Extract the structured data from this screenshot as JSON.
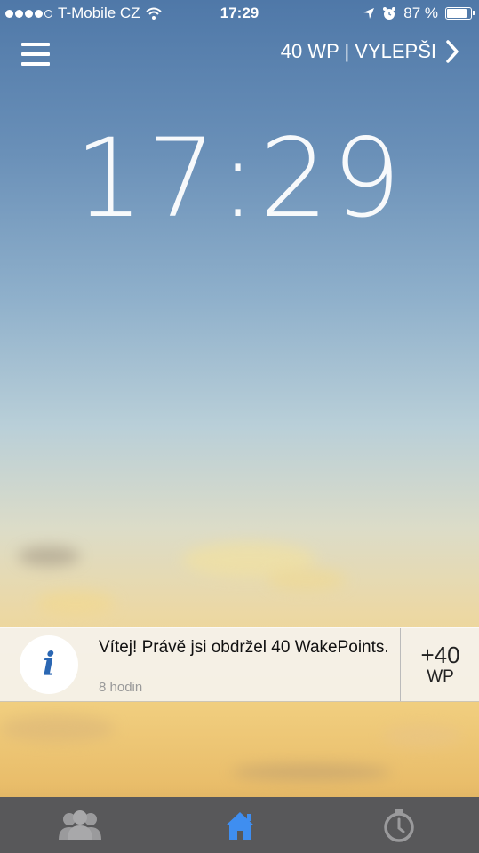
{
  "status_bar": {
    "carrier": "T-Mobile CZ",
    "time": "17:29",
    "battery": "87 %",
    "signal_bars": 4
  },
  "header": {
    "points_upgrade": "40 WP | VYLEPŠI"
  },
  "clock": {
    "time": "17:29"
  },
  "notification": {
    "icon_letter": "i",
    "message": "Vítej! Právě jsi obdržel 40 WakePoints.",
    "time_ago": "8 hodin",
    "reward_amount": "+40",
    "reward_unit": "WP"
  },
  "tabbar": {
    "tabs": [
      {
        "icon": "people-icon",
        "active": false
      },
      {
        "icon": "home-icon",
        "active": true
      },
      {
        "icon": "stopwatch-icon",
        "active": false
      }
    ],
    "active_color": "#3f8ef0",
    "inactive_color": "#9a9a9c"
  }
}
